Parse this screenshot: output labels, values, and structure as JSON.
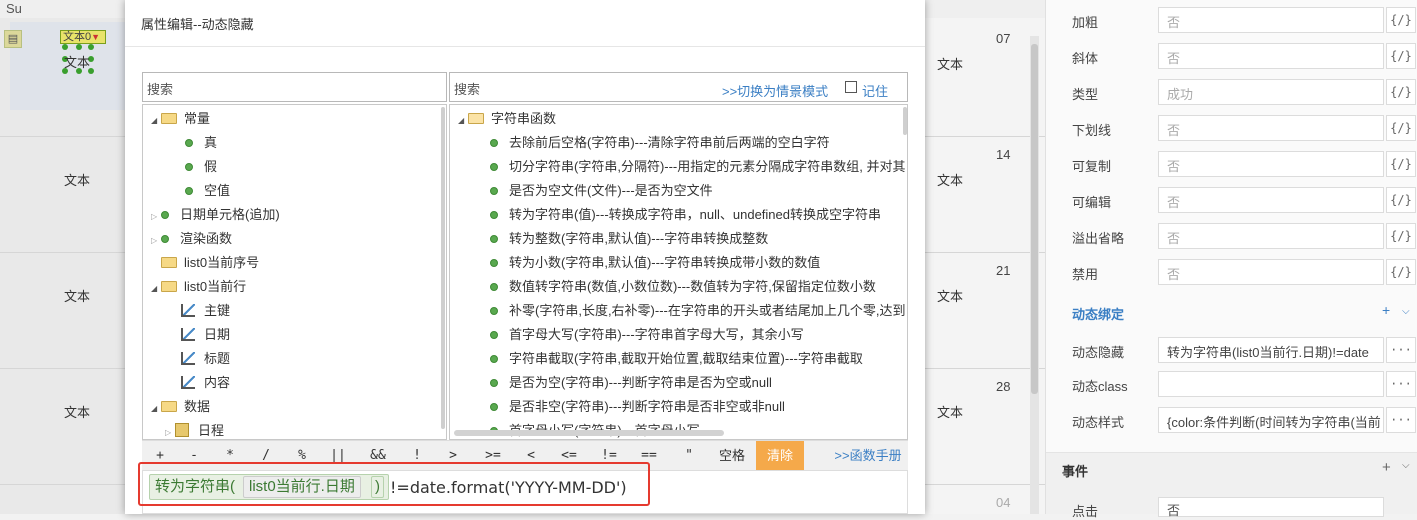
{
  "background": {
    "su_label": "Su",
    "cell_text": "文本",
    "selected_label": "文本0",
    "days": [
      "07",
      "14",
      "21",
      "28",
      "04"
    ]
  },
  "dialog": {
    "title": "属性编辑--动态隐藏",
    "left_search": {
      "placeholder": "搜索"
    },
    "right_search": {
      "placeholder": "搜索",
      "mode_link": ">>切换为情景模式",
      "remember_label": "记住"
    },
    "left_tree": [
      {
        "label": "常量",
        "kind": "folder",
        "expanded": true
      },
      {
        "label": "真",
        "kind": "dot"
      },
      {
        "label": "假",
        "kind": "dot"
      },
      {
        "label": "空值",
        "kind": "dot"
      },
      {
        "label": "日期单元格(追加)",
        "kind": "dot-collapsed"
      },
      {
        "label": "渲染函数",
        "kind": "dot-collapsed"
      },
      {
        "label": "list0当前序号",
        "kind": "folder-leaf"
      },
      {
        "label": "list0当前行",
        "kind": "folder",
        "expanded": true
      },
      {
        "label": "主键",
        "kind": "field"
      },
      {
        "label": "日期",
        "kind": "field"
      },
      {
        "label": "标题",
        "kind": "field"
      },
      {
        "label": "内容",
        "kind": "field"
      },
      {
        "label": "数据",
        "kind": "folder",
        "expanded": true
      },
      {
        "label": "日程",
        "kind": "db"
      }
    ],
    "right_tree": {
      "root": "字符串函数",
      "items": [
        "去除前后空格(字符串)---清除字符串前后两端的空白字符",
        "切分字符串(字符串,分隔符)---用指定的元素分隔成字符串数组, 并对其",
        "是否为空文件(文件)---是否为空文件",
        "转为字符串(值)---转换成字符串，null、undefined转换成空字符串",
        "转为整数(字符串,默认值)---字符串转换成整数",
        "转为小数(字符串,默认值)---字符串转换成带小数的数值",
        "数值转字符串(数值,小数位数)---数值转为字符,保留指定位数小数",
        "补零(字符串,长度,右补零)---在字符串的开头或者结尾加上几个零,达到",
        "首字母大写(字符串)---字符串首字母大写，其余小写",
        "字符串截取(字符串,截取开始位置,截取结束位置)---字符串截取",
        "是否为空(字符串)---判断字符串是否为空或null",
        "是否非空(字符串)---判断字符串是否非空或非null",
        "首字母小写(字符串)---首字母小写"
      ]
    },
    "operators": [
      "+",
      "-",
      "*",
      "/",
      "%",
      "||",
      "&&",
      "!",
      ">",
      ">=",
      "<",
      "<=",
      "!=",
      "==",
      "\"",
      "空格"
    ],
    "clear_label": "清除",
    "manual_link": ">>函数手册",
    "expression": {
      "func_chip": "转为字符串(",
      "arg_chip": "list0当前行.日期",
      "close_paren": ")",
      "tail": "!=date.format('YYYY-MM-DD')"
    }
  },
  "props": {
    "rows": [
      {
        "label": "加粗",
        "value": "否"
      },
      {
        "label": "斜体",
        "value": "否"
      },
      {
        "label": "类型",
        "value": "成功"
      },
      {
        "label": "下划线",
        "value": "否"
      },
      {
        "label": "可复制",
        "value": "否"
      },
      {
        "label": "可编辑",
        "value": "否"
      },
      {
        "label": "溢出省略",
        "value": "否"
      },
      {
        "label": "禁用",
        "value": "否"
      }
    ],
    "expr_btn": "{/}",
    "dyn_section": "动态绑定",
    "dyn_rows": [
      {
        "label": "动态隐藏",
        "value": "转为字符串(list0当前行.日期)!=date"
      },
      {
        "label": "动态class",
        "value": ""
      },
      {
        "label": "动态样式",
        "value": "{color:条件判断(时间转为字符串(当前"
      }
    ],
    "more_btn": "···",
    "events_title": "事件",
    "events_plus": "+",
    "events_chevron": "⌵",
    "event_row": {
      "label": "点击",
      "value": "否"
    }
  }
}
